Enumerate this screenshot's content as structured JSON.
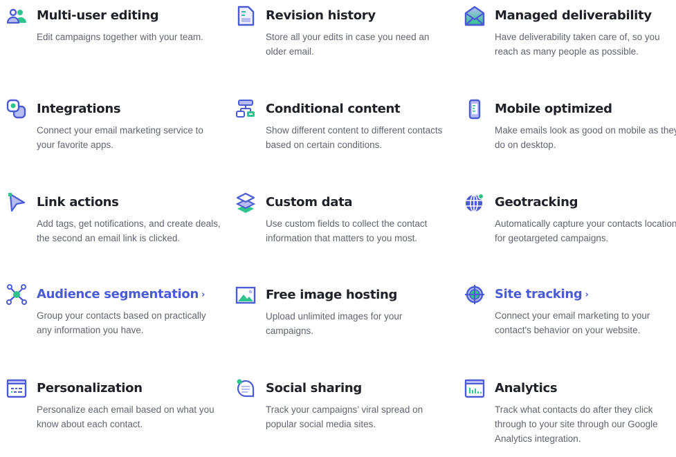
{
  "colors": {
    "heading": "#1f2129",
    "link": "#4a5bd4",
    "body": "#5f6470",
    "icon_primary": "#4a5bd4",
    "icon_light": "#b7bdf2",
    "icon_accent": "#2fc48d"
  },
  "features": [
    {
      "title": "Multi-user editing",
      "description": "Edit campaigns together with your team.",
      "icon": "users-icon",
      "link": false
    },
    {
      "title": "Revision history",
      "description": "Store all your edits in case you need an older email.",
      "icon": "document-icon",
      "link": false
    },
    {
      "title": "Managed deliverability",
      "description": "Have deliverability taken care of, so you reach as many people as possible.",
      "icon": "envelope-icon",
      "link": false
    },
    {
      "title": "Integrations",
      "description": "Connect your email marketing service to your favorite apps.",
      "icon": "integrations-icon",
      "link": false
    },
    {
      "title": "Conditional content",
      "description": "Show different content to different contacts based on certain conditions.",
      "icon": "flowchart-icon",
      "link": false
    },
    {
      "title": "Mobile optimized",
      "description": "Make emails look as good on mobile as they do on desktop.",
      "icon": "mobile-icon",
      "link": false
    },
    {
      "title": "Link actions",
      "description": "Add tags, get notifications, and create deals, the second an email link is clicked.",
      "icon": "cursor-icon",
      "link": false
    },
    {
      "title": "Custom data",
      "description": "Use custom fields to collect the contact information that matters to you most.",
      "icon": "layers-icon",
      "link": false
    },
    {
      "title": "Geotracking",
      "description": "Automatically capture your contacts location for geotargeted campaigns.",
      "icon": "globe-icon",
      "link": false
    },
    {
      "title": "Audience segmentation",
      "description": "Group your contacts based on practically any information you have.",
      "icon": "network-icon",
      "link": true,
      "chevron": "›"
    },
    {
      "title": "Free image hosting",
      "description": "Upload unlimited images for your campaigns.",
      "icon": "image-icon",
      "link": false
    },
    {
      "title": "Site tracking",
      "description": "Connect your email marketing to your contact's behavior on your website.",
      "icon": "target-icon",
      "link": true,
      "chevron": "›"
    },
    {
      "title": "Personalization",
      "description": "Personalize each email based on what you know about each contact.",
      "icon": "browser-form-icon",
      "link": false
    },
    {
      "title": "Social sharing",
      "description": "Track your campaigns’ viral spread on popular social media sites.",
      "icon": "chat-bubble-icon",
      "link": false
    },
    {
      "title": "Analytics",
      "description": "Track what contacts do after they click through to your site through our Google Analytics integration.",
      "icon": "analytics-icon",
      "link": false
    }
  ]
}
